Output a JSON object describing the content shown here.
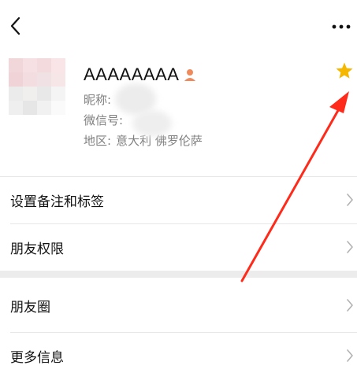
{
  "header": {
    "back_icon": "chevron-left-icon",
    "more_icon": "ellipsis-icon"
  },
  "profile": {
    "name": "AAAAAAAA",
    "gender_icon": "person-icon",
    "nickname_label": "昵称:",
    "wechat_id_label": "微信号:",
    "region_label": "地区:",
    "region_value": "意大利  佛罗伦萨",
    "star_icon": "star-icon",
    "star_color": "#f5b700"
  },
  "menu": {
    "remark_tags": "设置备注和标签",
    "friend_permissions": "朋友权限",
    "moments": "朋友圈",
    "more_info": "更多信息"
  },
  "annotation": {
    "arrow_color": "#ff2a1a"
  }
}
